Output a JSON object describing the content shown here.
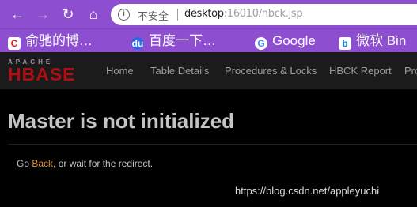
{
  "browser": {
    "insecure_label": "不安全",
    "url_host": "desktop",
    "url_rest": ":16010/hbck.jsp"
  },
  "bookmarks": [
    {
      "label": "俞驰的博…",
      "icon": "C"
    },
    {
      "label": "百度一下…",
      "icon": "du"
    },
    {
      "label": "Google",
      "icon": "G"
    },
    {
      "label": "微软 Bin",
      "icon": "b"
    }
  ],
  "logo": {
    "top": "APACHE",
    "main": "HBASE"
  },
  "nav": {
    "home": "Home",
    "table_details": "Table Details",
    "procedures": "Procedures & Locks",
    "hbck": "HBCK Report",
    "overflow": "Pro"
  },
  "content": {
    "heading": "Master is not initialized",
    "msg_prefix": "Go ",
    "back_link": "Back",
    "msg_suffix": ", or wait for the redirect."
  },
  "watermark": "https://blog.csdn.net/appleyuchi",
  "colors": {
    "accent": "#8d4fd0",
    "link": "#e08f35",
    "logo_red": "#b00e13"
  }
}
